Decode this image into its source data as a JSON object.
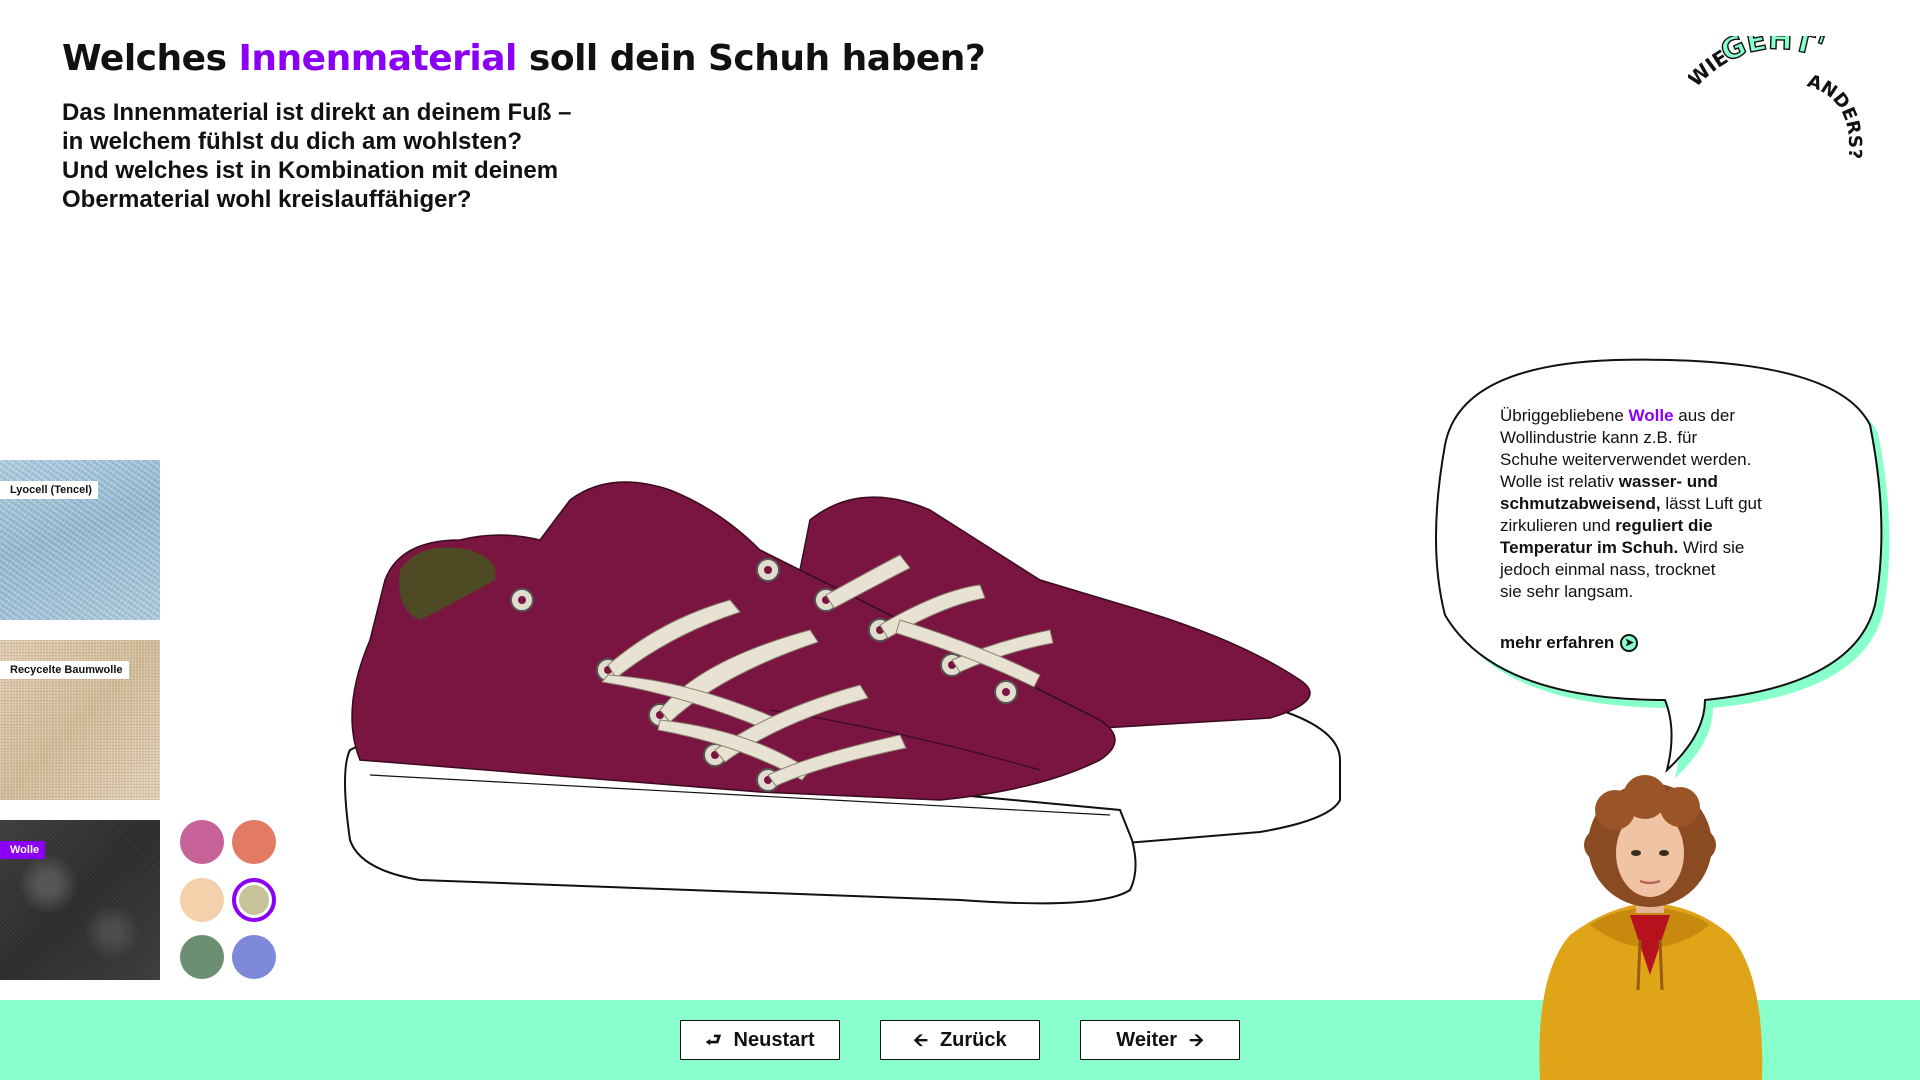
{
  "header": {
    "title_before": "Welches ",
    "title_accent": "Innenmaterial",
    "title_after": " soll dein Schuh haben?",
    "subtitle_lines": [
      "Das Innenmaterial ist direkt an deinem Fuß –",
      "in welchem fühlst du dich am wohlsten?",
      "Und welches ist in Kombination mit deinem",
      "Obermaterial wohl kreislauffähiger?"
    ]
  },
  "logo": {
    "word1": "WIE",
    "word2": "GEHT'S",
    "word3": "ANDERS?"
  },
  "materials": [
    {
      "label": "Lyocell (Tencel)",
      "selected": false
    },
    {
      "label": "Recycelte Baumwolle",
      "selected": false
    },
    {
      "label": "Wolle",
      "selected": true
    }
  ],
  "colors": [
    {
      "hex": "#c66297",
      "selected": false
    },
    {
      "hex": "#e37a64",
      "selected": false
    },
    {
      "hex": "#f4d1ab",
      "selected": false
    },
    {
      "hex": "#c8c29a",
      "selected": true
    },
    {
      "hex": "#6b8f70",
      "selected": false
    },
    {
      "hex": "#7e8ad9",
      "selected": false
    }
  ],
  "info": {
    "p1": "Übriggebliebene ",
    "p1_accent": "Wolle",
    "p1b": " aus der",
    "p2": "Wollindustrie kann z.B. für",
    "p3": "Schuhe weiterverwendet werden.",
    "p4": "Wolle ist relativ ",
    "p4_bold": "wasser- und",
    "p5_bold": "schmutzabweisend,",
    "p5": " lässt Luft gut",
    "p6": "zirkulieren und ",
    "p6_bold": "reguliert die",
    "p7_bold": "Temperatur im Schuh.",
    "p7": " Wird sie",
    "p8": "jedoch einmal nass, trocknet",
    "p9": "sie sehr langsam.",
    "more_label": "mehr erfahren",
    "more_icon": "arrow-right-circle-icon"
  },
  "nav": {
    "restart_label": "Neustart",
    "back_label": "Zurück",
    "next_label": "Weiter"
  },
  "theme": {
    "accent": "#8b00f5",
    "footer_bg": "#89ffcb",
    "shoe_upper": "#7a1541",
    "shoe_lining": "#4e4a24",
    "laces": "#e8e2d2"
  }
}
